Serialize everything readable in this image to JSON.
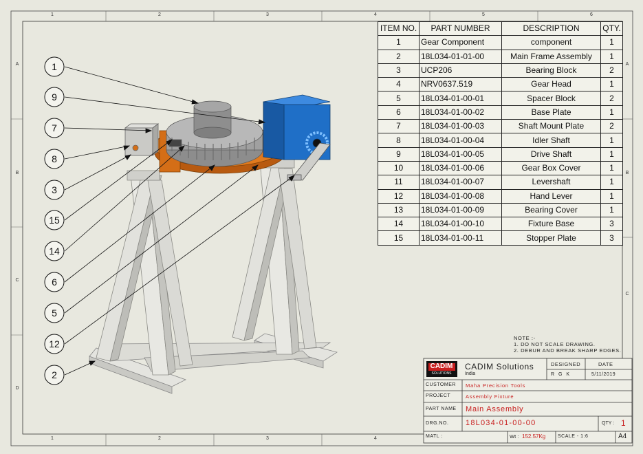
{
  "zones": {
    "columns": [
      "1",
      "2",
      "3",
      "4",
      "5",
      "6"
    ],
    "rows": [
      "A",
      "B",
      "C",
      "D"
    ]
  },
  "bom": {
    "headers": [
      "ITEM NO.",
      "PART NUMBER",
      "DESCRIPTION",
      "QTY."
    ],
    "rows": [
      [
        "1",
        "Gear Component",
        "component",
        "1"
      ],
      [
        "2",
        "18L034-01-01-00",
        "Main Frame Assembly",
        "1"
      ],
      [
        "3",
        "UCP206",
        "Bearing Block",
        "2"
      ],
      [
        "4",
        "NRV0637.519",
        "Gear Head",
        "1"
      ],
      [
        "5",
        "18L034-01-00-01",
        "Spacer Block",
        "2"
      ],
      [
        "6",
        "18L034-01-00-02",
        "Base Plate",
        "1"
      ],
      [
        "7",
        "18L034-01-00-03",
        "Shaft Mount Plate",
        "2"
      ],
      [
        "8",
        "18L034-01-00-04",
        "Idler Shaft",
        "1"
      ],
      [
        "9",
        "18L034-01-00-05",
        "Drive Shaft",
        "1"
      ],
      [
        "10",
        "18L034-01-00-06",
        "Gear Box Cover",
        "1"
      ],
      [
        "11",
        "18L034-01-00-07",
        "Levershaft",
        "1"
      ],
      [
        "12",
        "18L034-01-00-08",
        "Hand Lever",
        "1"
      ],
      [
        "13",
        "18L034-01-00-09",
        "Bearing Cover",
        "1"
      ],
      [
        "14",
        "18L034-01-00-10",
        "Fixture Base",
        "3"
      ],
      [
        "15",
        "18L034-01-00-11",
        "Stopper Plate",
        "3"
      ]
    ]
  },
  "balloons": [
    "1",
    "9",
    "7",
    "8",
    "3",
    "15",
    "14",
    "6",
    "5",
    "12",
    "2"
  ],
  "notes": {
    "title": "NOTE :-",
    "line1": "1. DO NOT SCALE DRAWING.",
    "line2": "2. DEBUR AND BREAK SHARP EDGES."
  },
  "title_block": {
    "logo_text": "CADIM",
    "logo_sub": "SOLUTIONS",
    "company": "CADIM Solutions",
    "country": "India",
    "designed_label": "DESIGNED",
    "designed_value": "R G K",
    "date_label": "DATE",
    "date_value": "5/11/2019",
    "customer_label": "CUSTOMER",
    "customer_value": "Maha Precision Tools",
    "project_label": "PROJECT",
    "project_value": "Assembly Fixture",
    "partname_label": "PART NAME",
    "partname_value": "Main Assembly",
    "drgno_label": "DRG.NO.",
    "drgno_value": "18L034-01-00-00",
    "qty_label": "QTY :",
    "qty_value": "1",
    "matl_label": "MATL :",
    "wt_label": "Wt :",
    "wt_value": "152.57Kg",
    "scale_label": "SCALE - 1:6",
    "sheet_size": "A4"
  },
  "colors": {
    "frame": "#d9d9d4",
    "gear_plate": "#e07a1e",
    "gearbox": "#1f6fc7",
    "gear": "#a8a8a8",
    "accent_red": "#c81e1e"
  }
}
